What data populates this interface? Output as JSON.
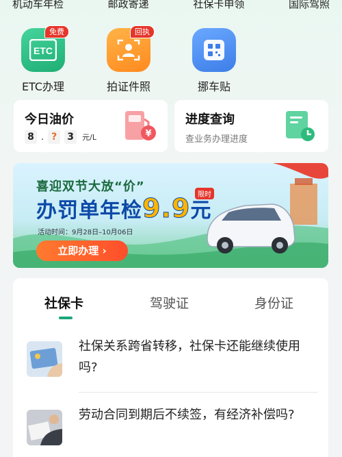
{
  "top_row": [
    "机动车年检",
    "邮政寄递",
    "社保卡申领",
    "国际驾照"
  ],
  "quick_services": [
    {
      "label": "ETC办理",
      "icon": "etc-icon",
      "icon_text": "ETC",
      "badge": "免费",
      "color": "#2fc08a"
    },
    {
      "label": "拍证件照",
      "icon": "id-photo-icon",
      "badge": "回执",
      "color": "#ff9a2f"
    },
    {
      "label": "挪车贴",
      "icon": "qr-code-icon",
      "badge": "",
      "color": "#4a8df0"
    }
  ],
  "fuel_card": {
    "title": "今日油价",
    "digits": [
      "8",
      "?",
      "3"
    ],
    "separator": ".",
    "unit": "元/L"
  },
  "progress_card": {
    "title": "进度查询",
    "subtitle": "查业务办理进度"
  },
  "banner": {
    "line1": "喜迎双节大放“价”",
    "line2": "办罚单年检",
    "price": "9.9",
    "price_unit": "元",
    "tag": "限时",
    "date": "活动时间：9月28日–10月06日",
    "button": "立即办理 ›"
  },
  "tabs": [
    {
      "label": "社保卡",
      "active": true
    },
    {
      "label": "驾驶证",
      "active": false
    },
    {
      "label": "身份证",
      "active": false
    }
  ],
  "articles": [
    {
      "title": "社保关系跨省转移，社保卡还能继续使用吗?"
    },
    {
      "title": "劳动合同到期后不续签，有经济补偿吗?"
    }
  ],
  "colors": {
    "accent": "#1aa57a",
    "badge_red": "#e5362b",
    "banner_button": "#ff5a2b"
  }
}
